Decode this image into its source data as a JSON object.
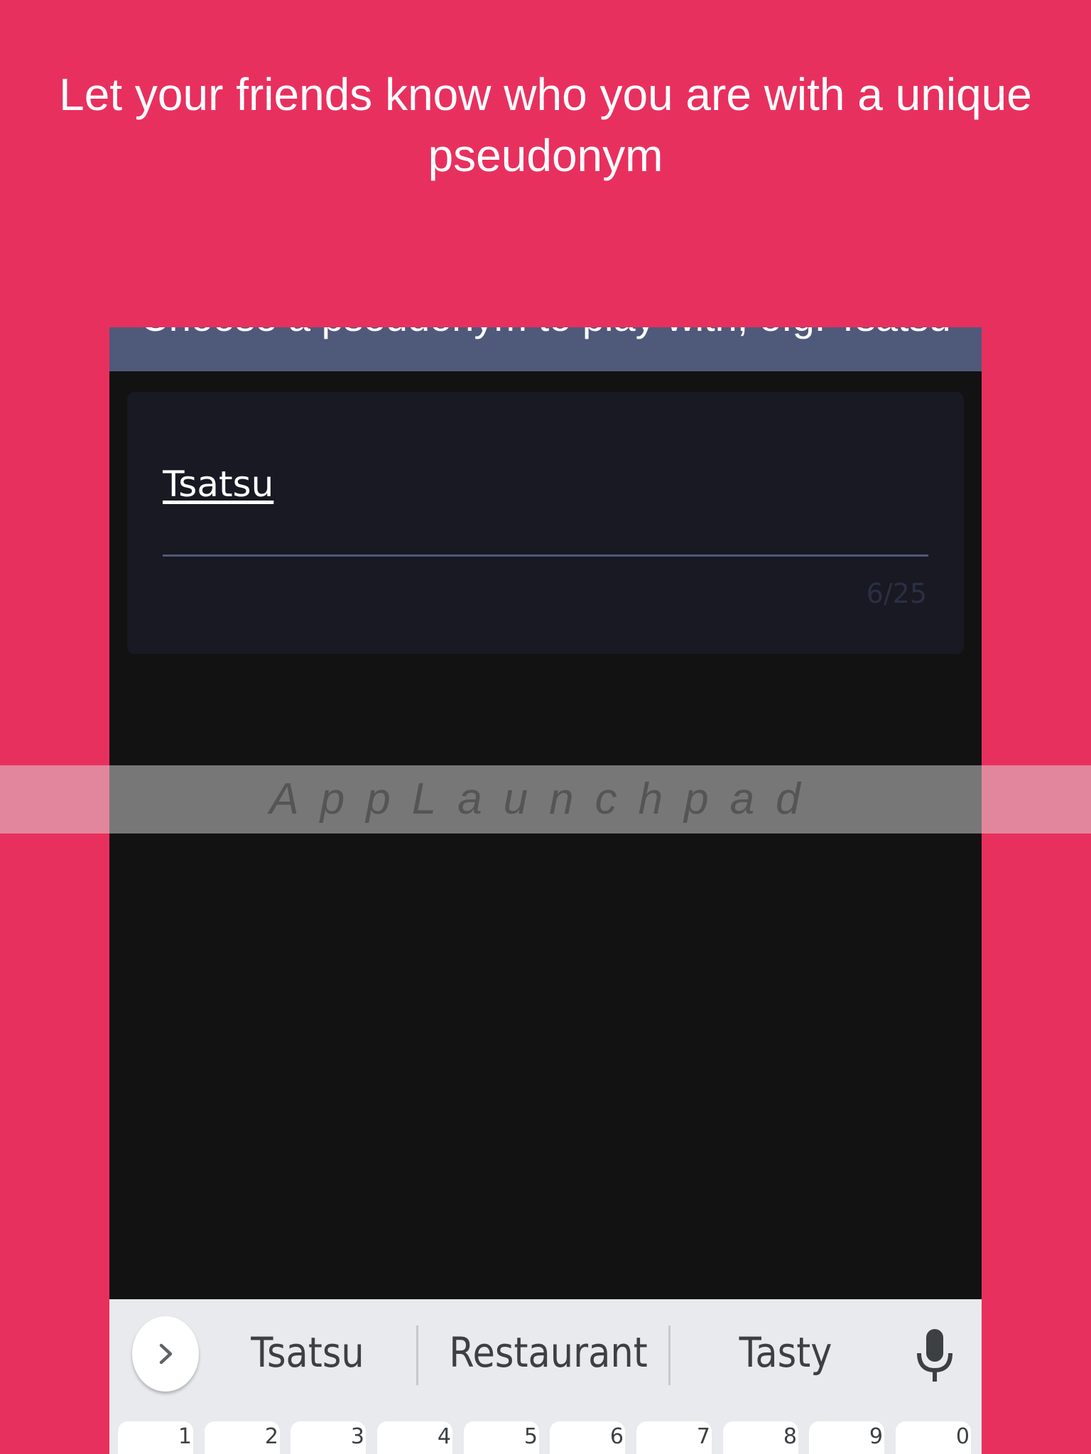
{
  "headline": "Let your friends know who you are with a unique pseudonym",
  "app_bar": {
    "title": "Choose a pseudonym to play with, e.g. Tsatsu"
  },
  "pseudonym_field": {
    "value": "Tsatsu",
    "counter": "6/25"
  },
  "watermark": "AppLaunchpad",
  "keyboard": {
    "suggestions": [
      "Tsatsu",
      "Restaurant",
      "Tasty"
    ],
    "number_keys": [
      "1",
      "2",
      "3",
      "4",
      "5",
      "6",
      "7",
      "8",
      "9",
      "0"
    ]
  },
  "colors": {
    "background": "#E8305E",
    "app_bar": "#4F597A",
    "screen": "#121212",
    "card": "#181922",
    "keyboard": "#E8EAED"
  }
}
